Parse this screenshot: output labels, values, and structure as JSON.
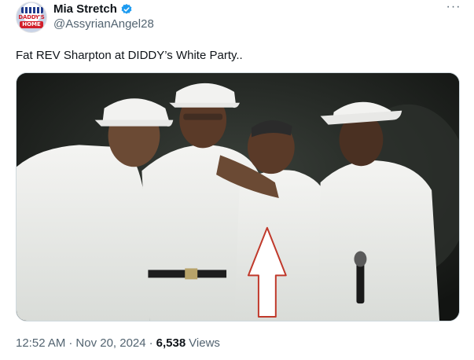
{
  "author": {
    "display_name": "Mia Stretch",
    "handle": "@AssyrianAngel28",
    "verified": true,
    "avatar_text_top": "DADDY'S",
    "avatar_text_bottom": "HOME"
  },
  "menu": {
    "more_label": "···"
  },
  "tweet": {
    "text": "Fat REV Sharpton at DIDDY’s White Party.."
  },
  "meta": {
    "time": "12:52 AM",
    "separator1": "·",
    "date": "Nov 20, 2024",
    "separator2": "·",
    "views": "6,538",
    "views_label": "Views"
  },
  "colors": {
    "verified_blue": "#1d9bf0",
    "text_primary": "#0f1419",
    "text_secondary": "#536471",
    "arrow_stroke": "#c0392b"
  }
}
